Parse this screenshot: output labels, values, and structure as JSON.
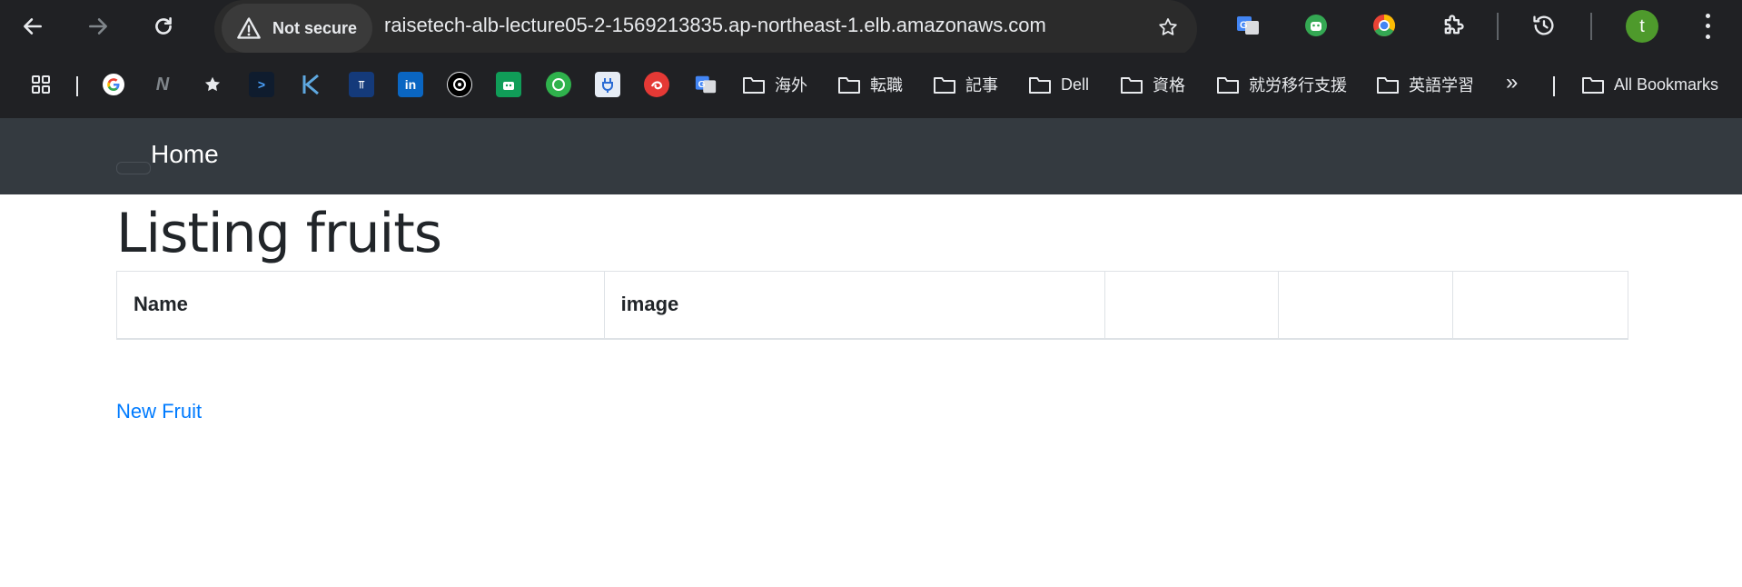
{
  "browser": {
    "security_label": "Not secure",
    "url": "raisetech-alb-lecture05-2-1569213835.ap-northeast-1.elb.amazonaws.com",
    "profile_initial": "t",
    "icons": {
      "back": "arrow-left-icon",
      "forward": "arrow-right-icon",
      "reload": "reload-icon",
      "warning": "warning-triangle-icon",
      "bookmark_star": "star-outline-icon",
      "extensions": [
        "google-translate-icon",
        "android-bot-icon",
        "chrome-clock-icon",
        "puzzle-icon",
        "history-icon"
      ]
    },
    "colors": {
      "toolbar_bg": "#202124",
      "text": "#e8eaed",
      "profile_bg": "#4e9a2c"
    }
  },
  "bookmarks": {
    "folders": [
      "海外",
      "転職",
      "記事",
      "Dell",
      "資格",
      "就労移行支援",
      "英語学習"
    ],
    "all_bookmarks_label": "All Bookmarks",
    "overflow_label": "»"
  },
  "page": {
    "navbar_brand": "Home",
    "title": "Listing fruits",
    "table": {
      "headers": [
        "Name",
        "image",
        "",
        "",
        ""
      ]
    },
    "new_link": "New Fruit",
    "colors": {
      "navbar_bg": "#343a40",
      "link": "#007bff",
      "text": "#212529"
    }
  }
}
